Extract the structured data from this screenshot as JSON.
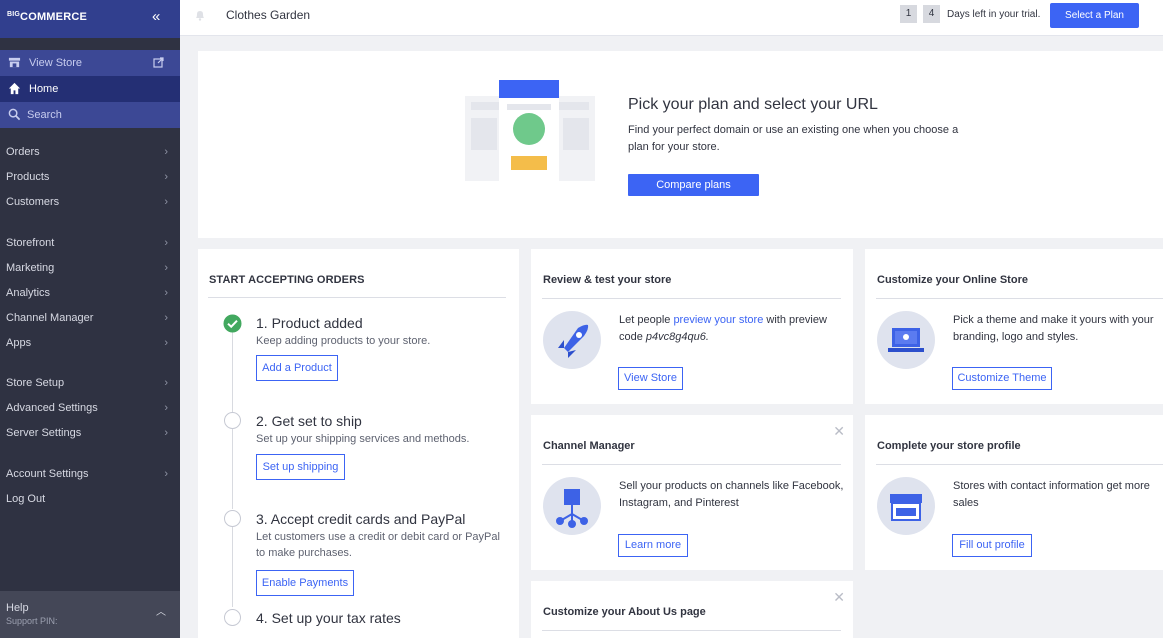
{
  "sidebar": {
    "logo": "COMMERCE",
    "logo_prefix": "BIG",
    "collapse": "«",
    "view_store": "View Store",
    "home": "Home",
    "search": "Search",
    "items": [
      {
        "label": "Orders"
      },
      {
        "label": "Products"
      },
      {
        "label": "Customers"
      },
      {
        "label": "Storefront"
      },
      {
        "label": "Marketing"
      },
      {
        "label": "Analytics"
      },
      {
        "label": "Channel Manager"
      },
      {
        "label": "Apps"
      },
      {
        "label": "Store Setup"
      },
      {
        "label": "Advanced Settings"
      },
      {
        "label": "Server Settings"
      },
      {
        "label": "Account Settings"
      },
      {
        "label": "Log Out"
      }
    ],
    "help": "Help",
    "support_pin": "Support PIN:"
  },
  "header": {
    "store_name": "Clothes Garden",
    "days_digits": [
      "1",
      "4"
    ],
    "trial_text": "Days left in your trial.",
    "select_plan": "Select a Plan"
  },
  "hero": {
    "title": "Pick your plan and select your URL",
    "description": "Find your perfect domain or use an existing one when you choose a plan for your store.",
    "button": "Compare plans"
  },
  "orders": {
    "title": "START ACCEPTING ORDERS",
    "steps": [
      {
        "title": "1. Product added",
        "desc": "Keep adding products to your store.",
        "button": "Add a Product",
        "done": true
      },
      {
        "title": "2. Get set to ship",
        "desc": "Set up your shipping services and methods.",
        "button": "Set up shipping",
        "done": false
      },
      {
        "title": "3. Accept credit cards and PayPal",
        "desc": "Let customers use a credit or debit card or PayPal to make purchases.",
        "button": "Enable Payments",
        "done": false
      },
      {
        "title": "4. Set up your tax rates",
        "desc": "",
        "button": "",
        "done": false
      }
    ]
  },
  "cards": {
    "review": {
      "title": "Review & test your store",
      "desc_pre": "Let people ",
      "desc_link": "preview your store",
      "desc_post": " with preview code ",
      "code": "p4vc8g4qu6.",
      "button": "View Store"
    },
    "customize": {
      "title": "Customize your Online Store",
      "desc": "Pick a theme and make it yours with your branding, logo and styles.",
      "button": "Customize Theme"
    },
    "channel": {
      "title": "Channel Manager",
      "desc": "Sell your products on channels like Facebook, Instagram, and Pinterest",
      "button": "Learn more"
    },
    "profile": {
      "title": "Complete your store profile",
      "desc": "Stores with contact information get more sales",
      "button": "Fill out profile"
    },
    "about": {
      "title": "Customize your About Us page"
    }
  },
  "colors": {
    "accent": "#3c64f4",
    "sidebar": "#2f3242",
    "success": "#42a85f"
  }
}
